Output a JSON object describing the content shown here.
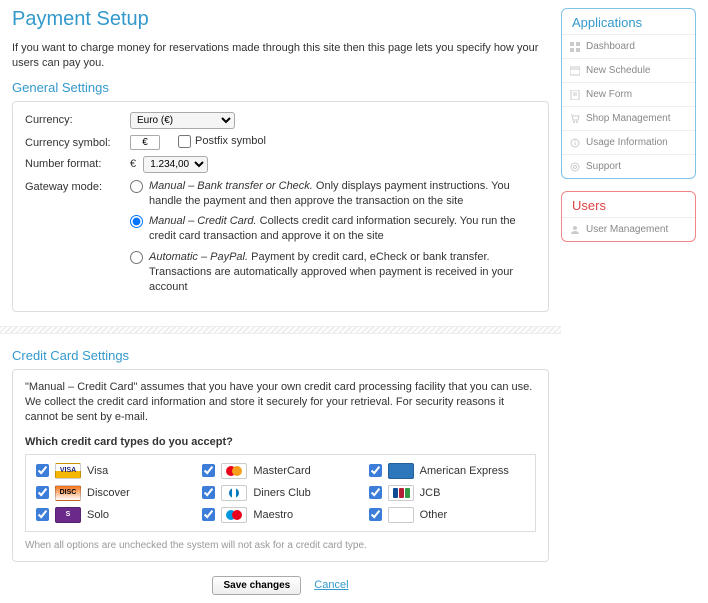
{
  "page": {
    "title": "Payment Setup",
    "intro": "If you want to charge money for reservations made through this site then this page lets you specify how your users can pay you."
  },
  "general": {
    "heading": "General Settings",
    "currency_label": "Currency:",
    "currency_value": "Euro (€)",
    "symbol_label": "Currency symbol:",
    "symbol_value": "€",
    "postfix_label": "Postfix symbol",
    "format_label": "Number format:",
    "format_prefix": "€",
    "format_value": "1.234,00",
    "gateway_label": "Gateway mode:",
    "modes": [
      {
        "em": "Manual – Bank transfer or Check.",
        "rest": " Only displays payment instructions. You handle the payment and then approve the transaction on the site"
      },
      {
        "em": "Manual – Credit Card.",
        "rest": " Collects credit card information securely. You run the credit card transaction and approve it on the site"
      },
      {
        "em": "Automatic – PayPal.",
        "rest": " Payment by credit card, eCheck or bank transfer. Transactions are automatically approved when payment is received in your account"
      }
    ],
    "selected_mode": 1
  },
  "cc": {
    "heading": "Credit Card Settings",
    "desc": "\"Manual – Credit Card\" assumes that you have your own credit card processing facility that you can use. We collect the credit card information and store it securely for your retrieval. For security reasons it cannot be sent by e-mail.",
    "question": "Which credit card types do you accept?",
    "types": [
      {
        "key": "visa",
        "label": "Visa"
      },
      {
        "key": "mastercard",
        "label": "MasterCard"
      },
      {
        "key": "amex",
        "label": "American Express"
      },
      {
        "key": "discover",
        "label": "Discover"
      },
      {
        "key": "diners",
        "label": "Diners Club"
      },
      {
        "key": "jcb",
        "label": "JCB"
      },
      {
        "key": "solo",
        "label": "Solo"
      },
      {
        "key": "maestro",
        "label": "Maestro"
      },
      {
        "key": "other",
        "label": "Other"
      }
    ],
    "note": "When all options are unchecked the system will not ask for a credit card type."
  },
  "actions": {
    "save": "Save changes",
    "cancel": "Cancel"
  },
  "sidebar": {
    "apps_title": "Applications",
    "apps": [
      {
        "icon": "dashboard",
        "label": "Dashboard"
      },
      {
        "icon": "calendar",
        "label": "New Schedule"
      },
      {
        "icon": "form",
        "label": "New Form"
      },
      {
        "icon": "cart",
        "label": "Shop Management"
      },
      {
        "icon": "info",
        "label": "Usage Information"
      },
      {
        "icon": "support",
        "label": "Support"
      }
    ],
    "users_title": "Users",
    "users": [
      {
        "icon": "user",
        "label": "User Management"
      }
    ]
  }
}
